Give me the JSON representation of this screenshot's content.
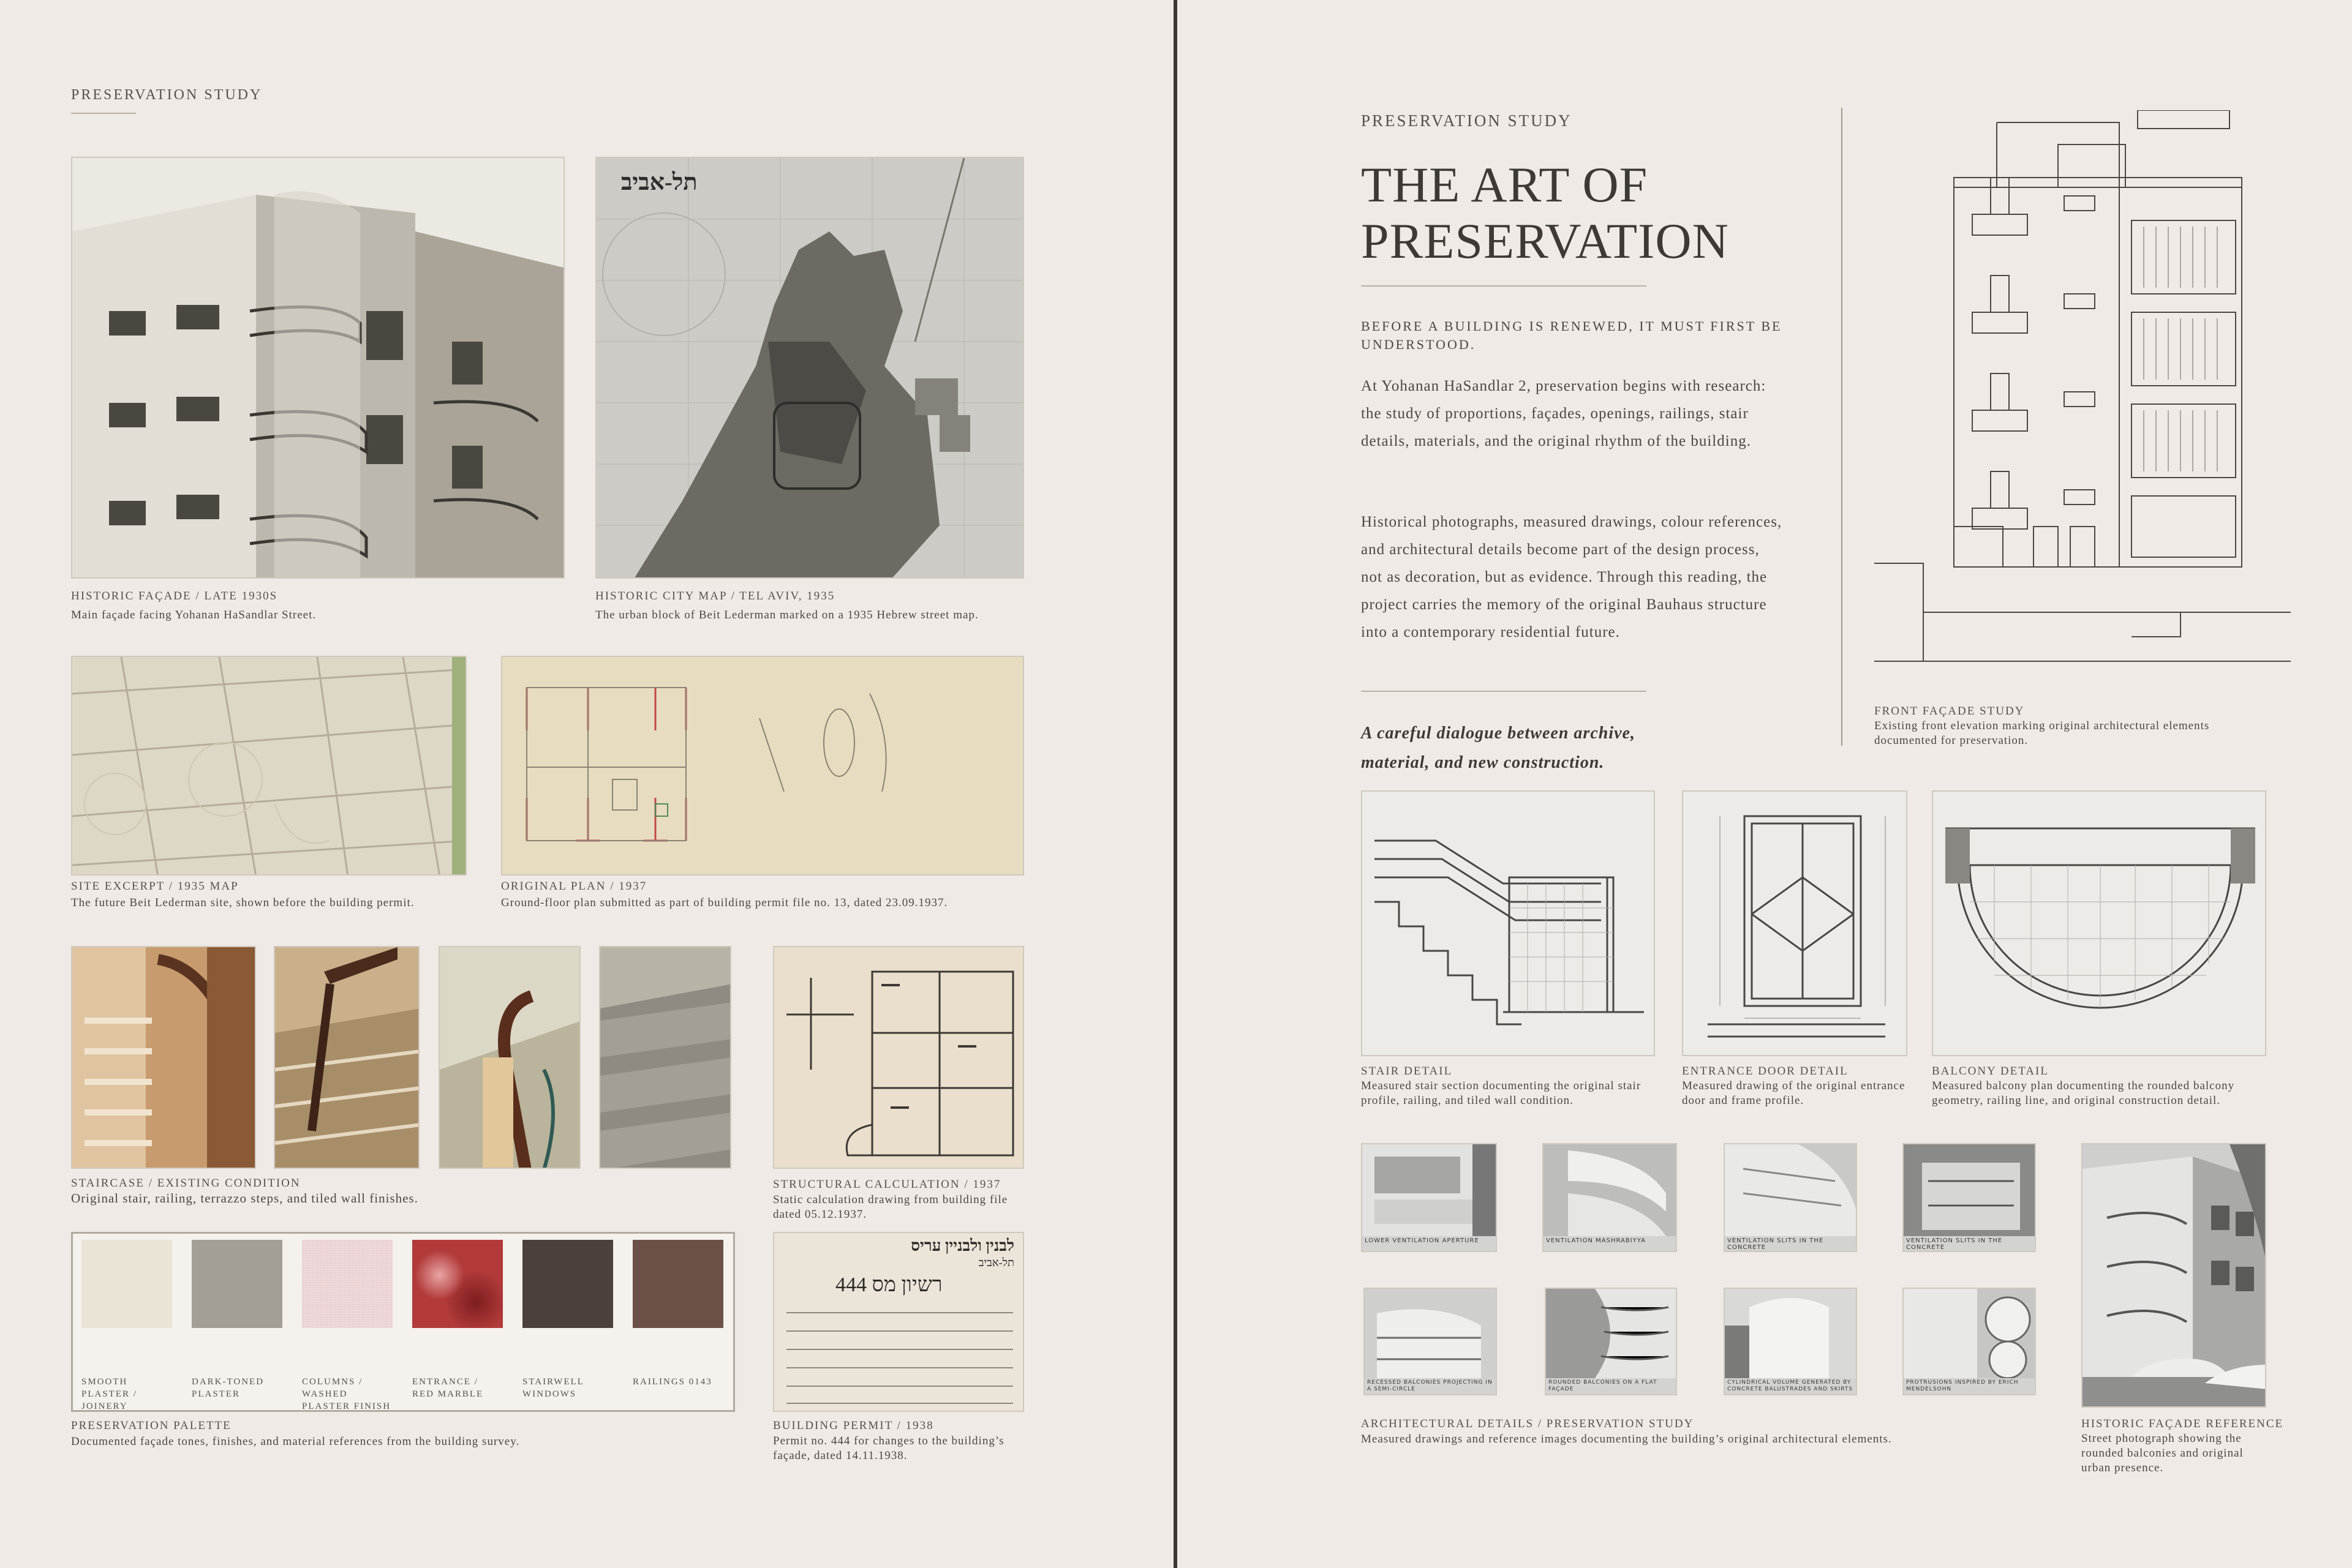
{
  "left": {
    "kicker": "PRESERVATION STUDY",
    "items": [
      {
        "title": "HISTORIC FAÇADE / LATE 1930S",
        "desc": "Main façade facing Yohanan HaSandlar Street."
      },
      {
        "title": "HISTORIC CITY MAP / TEL AVIV, 1935",
        "desc": "The urban block of Beit Lederman marked on a 1935 Hebrew street map."
      },
      {
        "title": "SITE EXCERPT / 1935 MAP",
        "desc": "The future Beit Lederman site, shown before the building permit."
      },
      {
        "title": "ORIGINAL PLAN / 1937",
        "desc": "Ground-floor plan submitted as part of building permit file no. 13, dated 23.09.1937."
      },
      {
        "title": "STAIRCASE / EXISTING CONDITION",
        "desc": "Original stair, railing, terrazzo steps, and tiled wall finishes."
      },
      {
        "title": "STRUCTURAL CALCULATION / 1937",
        "desc": "Static calculation drawing from building file dated 05.12.1937."
      },
      {
        "title": "PRESERVATION PALETTE",
        "desc": "Documented façade tones, finishes, and material references from the building survey."
      },
      {
        "title": "BUILDING PERMIT / 1938",
        "desc": "Permit no. 444 for changes to the building’s façade, dated 14.11.1938."
      }
    ],
    "map_header": "תל-אביב",
    "palette": [
      {
        "label": "SMOOTH PLASTER / JOINERY",
        "color": "#e9e4d6"
      },
      {
        "label": "DARK-TONED PLASTER",
        "color": "#a39f97"
      },
      {
        "label": "COLUMNS / WASHED PLASTER FINISH",
        "color": "#efd9da"
      },
      {
        "label": "ENTRANCE / RED MARBLE",
        "color": "#b23a3a"
      },
      {
        "label": "STAIRWELL WINDOWS",
        "color": "#4b403c"
      },
      {
        "label": "RAILINGS 0143",
        "color": "#6c5148"
      }
    ],
    "permit_header": "לבנין ולבניין עריס",
    "permit_sub": "תל-אביב",
    "permit_text": "רשיון מס 444"
  },
  "right": {
    "kicker": "PRESERVATION STUDY",
    "title_line1": "THE ART OF",
    "title_line2": "PRESERVATION",
    "subtitle": "BEFORE A BUILDING IS RENEWED, IT MUST FIRST BE UNDERSTOOD.",
    "para1": "At Yohanan HaSandlar 2, preservation begins with research: the study of proportions, façades, openings, railings, stair details, materials, and the original rhythm of the building.",
    "para2": "Historical photographs, measured drawings, colour references, and architectural details become part of the design process, not as decoration, but as evidence. Through this reading, the project carries the memory of the original Bauhaus structure into a contemporary residential future.",
    "quote": "A careful dialogue between archive, material, and new construction.",
    "front": {
      "title": "FRONT FAÇADE STUDY",
      "desc": "Existing front elevation marking original architectural elements documented for preservation."
    },
    "details": [
      {
        "title": "STAIR DETAIL",
        "desc": "Measured stair section documenting the original stair profile, railing, and tiled wall condition."
      },
      {
        "title": "ENTRANCE DOOR DETAIL",
        "desc": "Measured drawing of the original entrance door and frame profile."
      },
      {
        "title": "BALCONY DETAIL",
        "desc": "Measured balcony plan documenting the rounded balcony geometry, railing line, and original construction detail."
      }
    ],
    "arch_images": [
      "LOWER VENTILATION APERTURE",
      "VENTILATION MASHRABIYYA",
      "VENTILATION SLITS IN THE CONCRETE",
      "VENTILATION SLITS IN THE CONCRETE",
      "RECESSED BALCONIES PROJECTING IN A SEMI-CIRCLE",
      "ROUNDED BALCONIES ON A FLAT FAÇADE",
      "CYLINDRICAL VOLUME GENERATED BY CONCRETE BALUSTRADES AND SKIRTS",
      "PROTRUSIONS INSPIRED BY ERICH MENDELSOHN"
    ],
    "arch": {
      "title": "ARCHITECTURAL DETAILS / PRESERVATION STUDY",
      "desc": "Measured drawings and reference images documenting the building’s original architectural elements."
    },
    "street": {
      "title": "HISTORIC FAÇADE REFERENCE",
      "desc": "Street photograph showing the rounded balconies and original urban presence."
    }
  }
}
